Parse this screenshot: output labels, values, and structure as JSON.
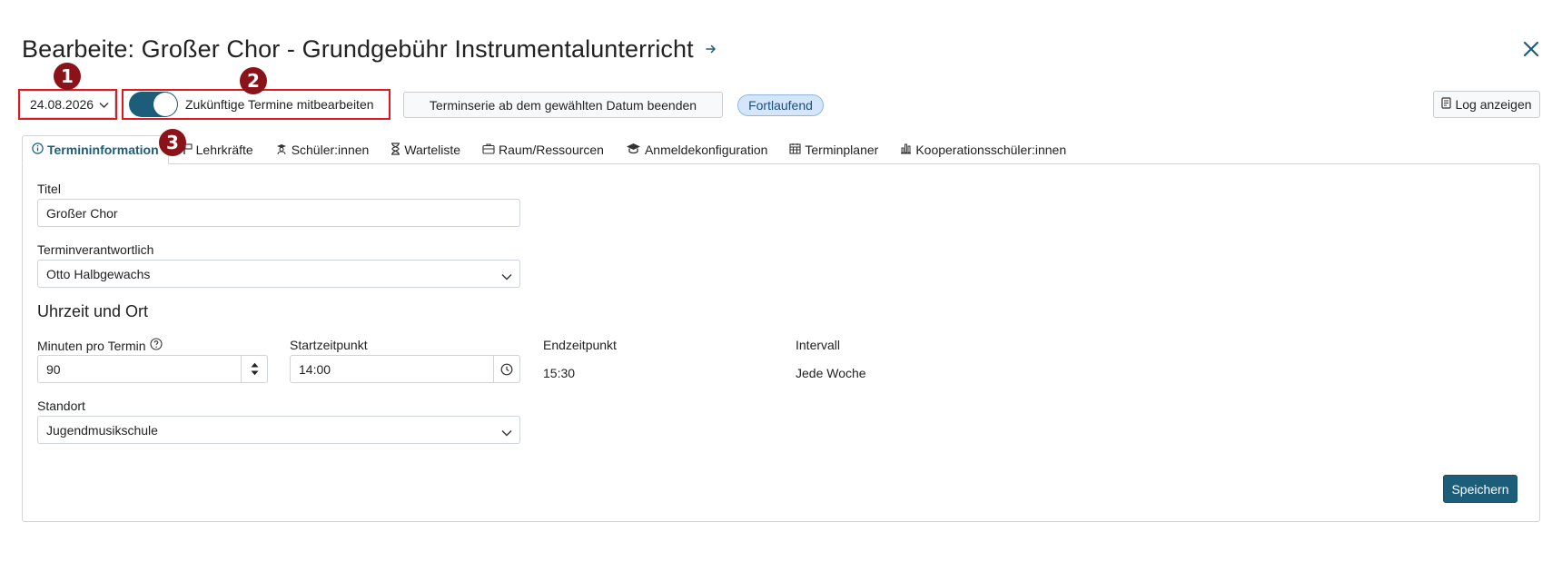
{
  "dialog": {
    "title": "Bearbeite: Großer Chor - Grundgebühr Instrumentalunterricht"
  },
  "toolbar": {
    "date_value": "24.08.2026",
    "toggle_label": "Zukünftige Termine mitbearbeiten",
    "toggle_on": true,
    "end_series_button": "Terminserie ab dem gewählten Datum beenden",
    "status_badge": "Fortlaufend",
    "log_button": "Log anzeigen"
  },
  "markers": [
    "1",
    "2",
    "3"
  ],
  "tabs": [
    {
      "label": "Termininformation",
      "icon": "info-icon",
      "active": true
    },
    {
      "label": "Lehrkräfte",
      "icon": "teacher-icon"
    },
    {
      "label": "Schüler:innen",
      "icon": "students-icon"
    },
    {
      "label": "Warteliste",
      "icon": "hourglass-icon"
    },
    {
      "label": "Raum/Ressourcen",
      "icon": "briefcase-icon"
    },
    {
      "label": "Anmeldekonfiguration",
      "icon": "graduation-cap-icon"
    },
    {
      "label": "Terminplaner",
      "icon": "calendar-icon"
    },
    {
      "label": "Kooperationsschüler:innen",
      "icon": "bar-chart-icon"
    }
  ],
  "form": {
    "title_label": "Titel",
    "title_value": "Großer Chor",
    "responsible_label": "Terminverantwortlich",
    "responsible_value": "Otto Halbgewachs",
    "section_heading": "Uhrzeit und Ort",
    "minutes_label": "Minuten pro Termin",
    "minutes_value": "90",
    "start_label": "Startzeitpunkt",
    "start_value": "14:00",
    "end_label": "Endzeitpunkt",
    "end_value": "15:30",
    "interval_label": "Intervall",
    "interval_value": "Jede Woche",
    "location_label": "Standort",
    "location_value": "Jugendmusikschule",
    "save_button": "Speichern"
  },
  "colors": {
    "primary": "#1c5d7a",
    "highlight_box": "#e0191f",
    "marker": "#8a1218",
    "badge_bg": "#d5e6fb"
  }
}
